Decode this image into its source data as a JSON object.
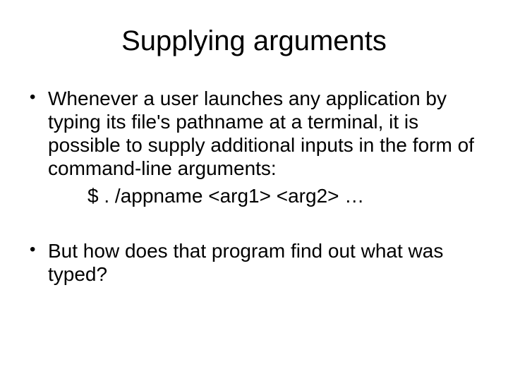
{
  "title": "Supplying arguments",
  "bullets": {
    "b1": "Whenever a user launches any application by typing its file's pathname at a terminal, it is possible to supply additional inputs in the form of command-line arguments:",
    "b1_sub": "$  . /appname  <arg1> <arg2> …",
    "b2": "But how does that program find out what was typed?"
  }
}
